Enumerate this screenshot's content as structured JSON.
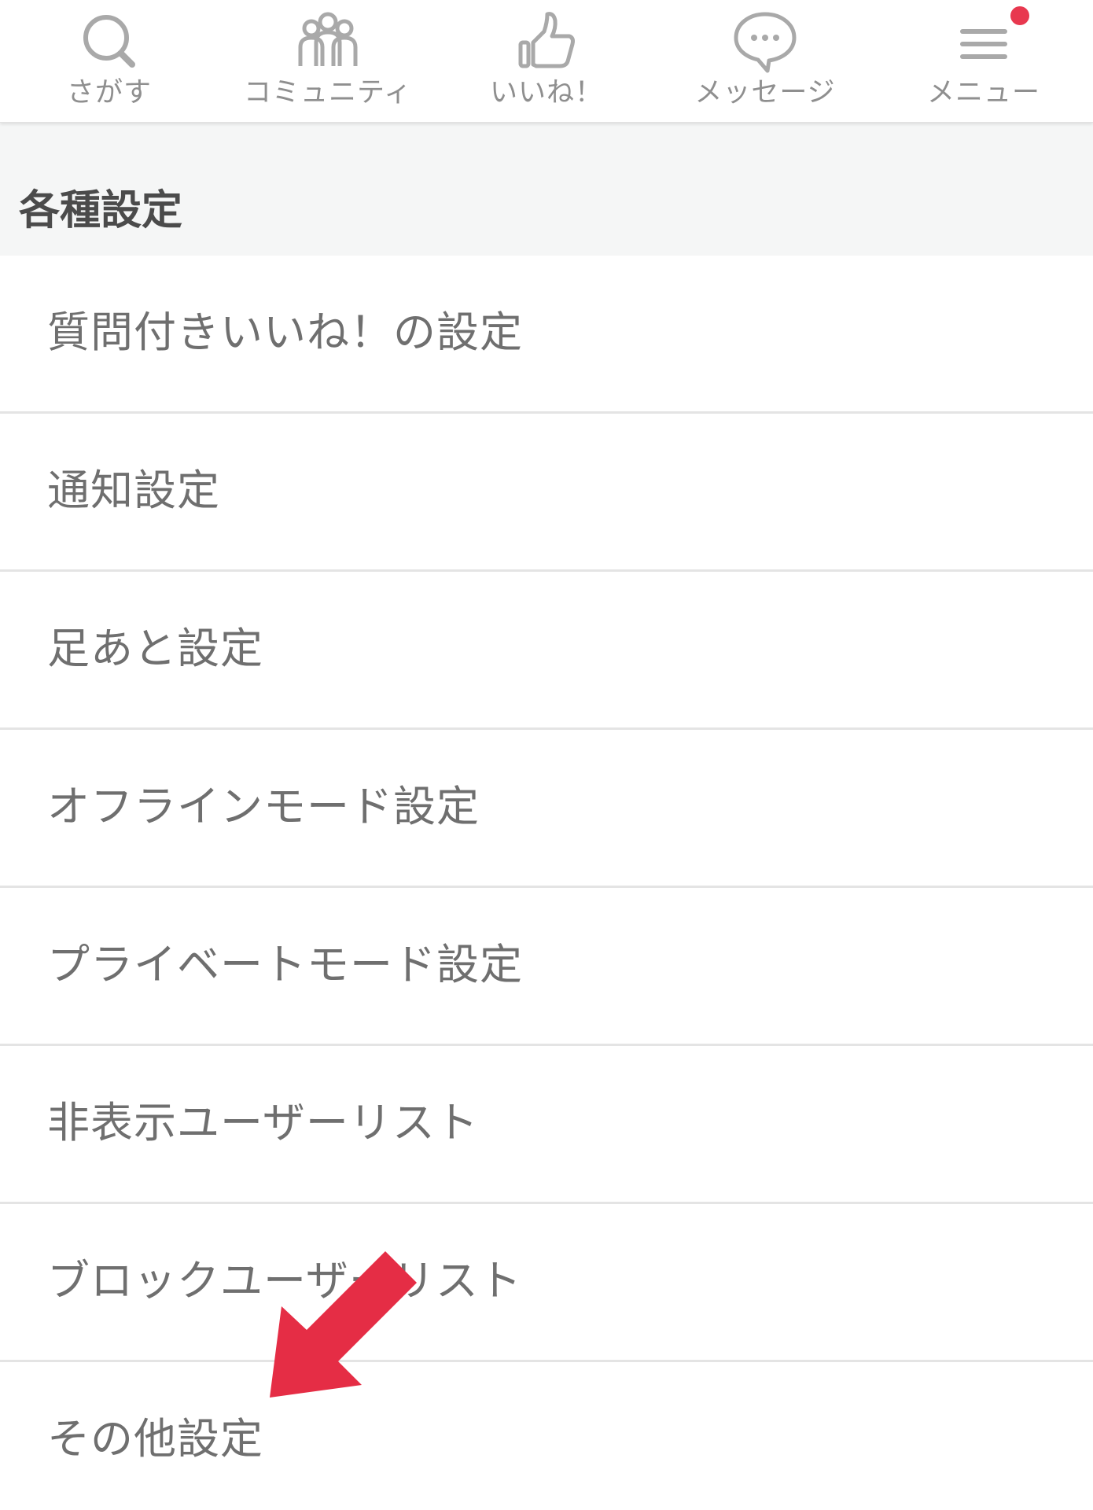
{
  "nav": {
    "items": [
      {
        "label": "さがす",
        "icon": "search-icon"
      },
      {
        "label": "コミュニティ",
        "icon": "community-icon"
      },
      {
        "label": "いいね！",
        "icon": "thumbs-up-icon"
      },
      {
        "label": "メッセージ",
        "icon": "chat-bubble-icon"
      },
      {
        "label": "メニュー",
        "icon": "menu-icon"
      }
    ],
    "menu_badge_color": "#e8384f"
  },
  "section": {
    "title": "各種設定"
  },
  "settings": {
    "items": [
      {
        "label": "質問付きいいね！の設定"
      },
      {
        "label": "通知設定"
      },
      {
        "label": "足あと設定"
      },
      {
        "label": "オフラインモード設定"
      },
      {
        "label": "プライベートモード設定"
      },
      {
        "label": "非表示ユーザーリスト"
      },
      {
        "label": "ブロックユーザーリスト"
      },
      {
        "label": "その他設定"
      }
    ]
  },
  "annotation": {
    "arrow_icon": "red-arrow-icon",
    "arrow_color": "#e52d45"
  }
}
